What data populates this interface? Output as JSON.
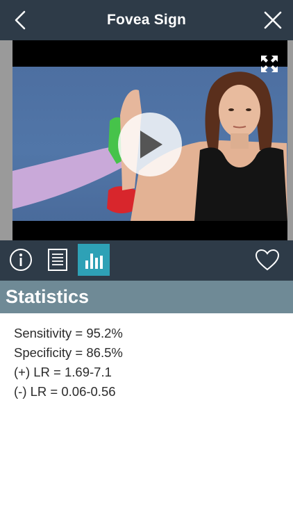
{
  "header": {
    "title": "Fovea Sign",
    "back_icon": "chevron-left-icon",
    "close_icon": "close-icon"
  },
  "video": {
    "play_icon": "play-icon",
    "fullscreen_icon": "fullscreen-icon"
  },
  "toolbar": {
    "tabs": [
      {
        "icon": "info-icon",
        "active": false
      },
      {
        "icon": "document-list-icon",
        "active": false
      },
      {
        "icon": "bar-chart-icon",
        "active": true
      }
    ],
    "favorite_icon": "heart-icon"
  },
  "section": {
    "title": "Statistics"
  },
  "statistics": [
    "Sensitivity = 95.2%",
    "Specificity = 86.5%",
    "(+) LR = 1.69-7.1",
    "(-) LR = 0.06-0.56"
  ],
  "colors": {
    "bar": "#2e3b48",
    "accent": "#2ea1b6",
    "section": "#6f8a96"
  }
}
